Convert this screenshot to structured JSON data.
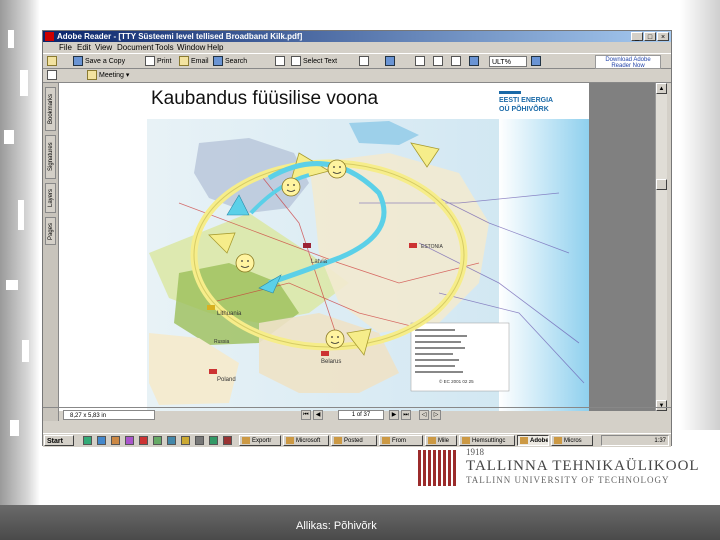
{
  "window": {
    "title": "Adobe Reader - [TTY Süsteemi level tellised Broadband Kilk.pdf]",
    "controls": [
      "_",
      "□",
      "×"
    ]
  },
  "menu": [
    "File",
    "Edit",
    "View",
    "Document",
    "Tools",
    "Window",
    "Help"
  ],
  "toolbar": {
    "save_copy": "Save a Copy",
    "print": "Print",
    "email": "Email",
    "search": "Search",
    "select_text": "Select Text",
    "zoom": "ULT%",
    "adobe_box": "Download Adobe Reader Now"
  },
  "toolbar2": {
    "dropdown": "Meeting"
  },
  "nav_tabs": [
    "Bookmarks",
    "Signatures",
    "Layers",
    "Pages"
  ],
  "slide": {
    "title": "Kaubandus füüsilise voona",
    "logo_line1": "EESTI ENERGIA",
    "logo_line2": "OÜ PÕHIVÕRK",
    "map_labels": [
      "Latvia",
      "Lithuania",
      "Belarus",
      "Poland",
      "Russia",
      "ESTONIA"
    ],
    "legend_note": "© EC 2001 02 25"
  },
  "statusbar": {
    "page_size": "8,27 x 5,83 in",
    "page_indicator": "1 of 37"
  },
  "taskbar": {
    "start": "Start",
    "tasks": [
      "Exportr",
      "Microsoft",
      "Posted",
      "From",
      "Mile",
      "Hemsuttingc",
      "Adobe",
      "Micros"
    ],
    "active_task": "Adobe",
    "clock": "1:37"
  },
  "university": {
    "year": "1918",
    "name": "TALLINNA TEHNIKAÜLIKOOL",
    "name_en": "TALLINN UNIVERSITY OF TECHNOLOGY"
  },
  "footer": {
    "source": "Allikas: Põhivõrk"
  },
  "colors": {
    "titlebar": "#0a246a",
    "arrow_yellow": "#f6ed8a",
    "arrow_cyan": "#5bd0e8",
    "university_red": "#9b2b2b"
  }
}
